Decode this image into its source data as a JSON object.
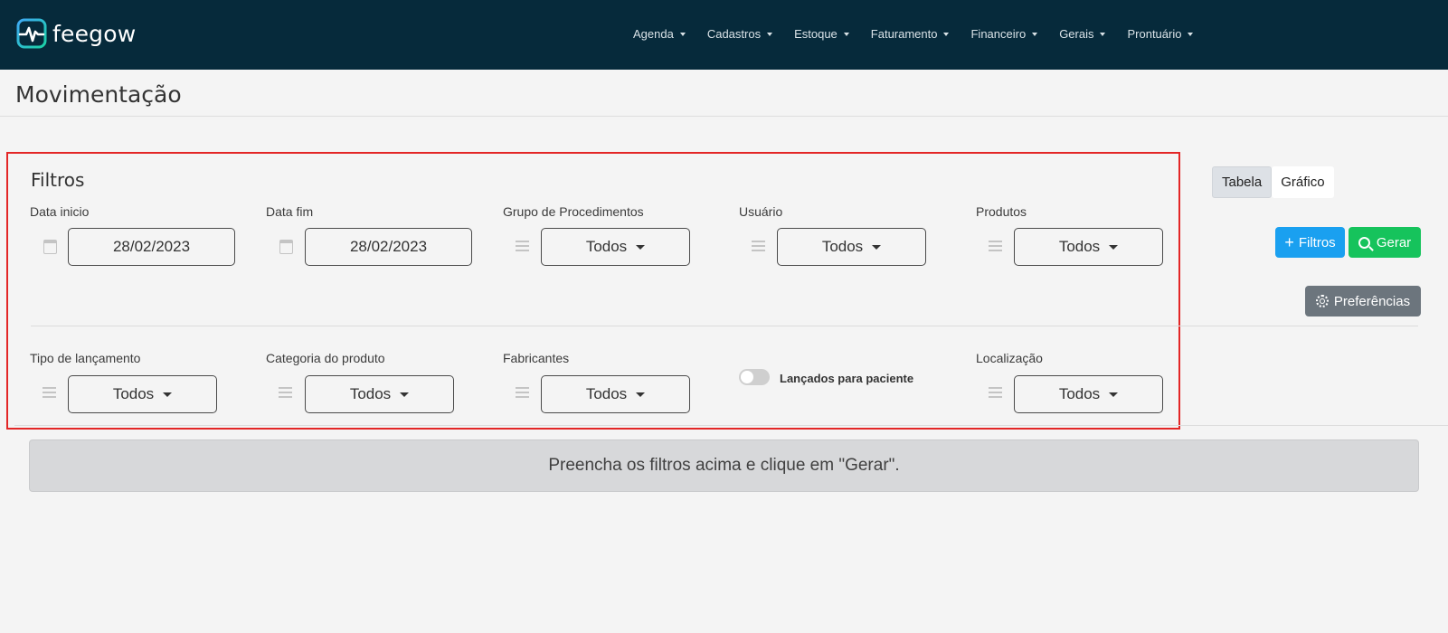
{
  "brand": {
    "name": "feegow",
    "accent": "#1bc6c0"
  },
  "nav": {
    "items": [
      {
        "label": "Agenda"
      },
      {
        "label": "Cadastros"
      },
      {
        "label": "Estoque"
      },
      {
        "label": "Faturamento"
      },
      {
        "label": "Financeiro"
      },
      {
        "label": "Gerais"
      },
      {
        "label": "Prontuário"
      }
    ]
  },
  "page": {
    "title": "Movimentação"
  },
  "filters": {
    "title": "Filtros",
    "data_inicio": {
      "label": "Data inicio",
      "value": "28/02/2023",
      "icon": "calendar-icon"
    },
    "data_fim": {
      "label": "Data fim",
      "value": "28/02/2023",
      "icon": "calendar-icon"
    },
    "grupo": {
      "label": "Grupo de Procedimentos",
      "value": "Todos"
    },
    "usuario": {
      "label": "Usuário",
      "value": "Todos"
    },
    "produtos": {
      "label": "Produtos",
      "value": "Todos"
    },
    "tipo": {
      "label": "Tipo de lançamento",
      "value": "Todos"
    },
    "categoria": {
      "label": "Categoria do produto",
      "value": "Todos"
    },
    "fabricantes": {
      "label": "Fabricantes",
      "value": "Todos"
    },
    "paciente_toggle": {
      "label": "Lançados para paciente",
      "checked": false
    },
    "localizacao": {
      "label": "Localização",
      "value": "Todos"
    }
  },
  "view_tabs": {
    "tabela": "Tabela",
    "grafico": "Gráfico",
    "active": "Tabela"
  },
  "actions": {
    "filtros_label": "Filtros",
    "gerar_label": "Gerar",
    "preferencias_label": "Preferências"
  },
  "notice": {
    "text": "Preencha os filtros acima e clique em \"Gerar\"."
  },
  "colors": {
    "topbar": "#062a3b",
    "filtros_btn": "#1aa0f0",
    "gerar_btn": "#16c35c",
    "pref_btn": "#6c757d",
    "highlight": "#e32626"
  }
}
